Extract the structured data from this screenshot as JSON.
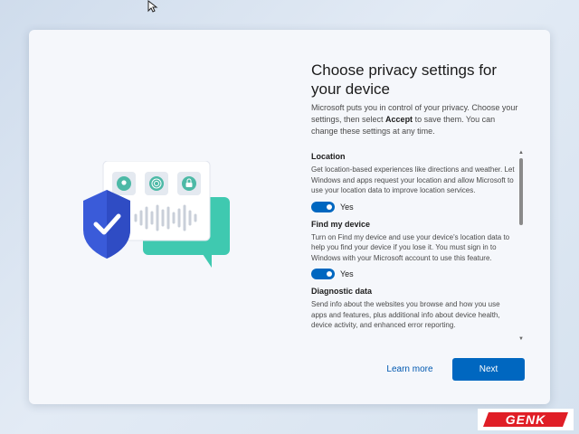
{
  "dialog": {
    "title": "Choose privacy settings for your device",
    "intro_before": "Microsoft puts you in control of your privacy. Choose your settings, then select ",
    "intro_bold": "Accept",
    "intro_after": " to save them. You can change these settings at any time."
  },
  "sections": [
    {
      "title": "Location",
      "description": "Get location-based experiences like directions and weather. Let Windows and apps request your location and allow Microsoft to use your location data to improve location services.",
      "toggle_label": "Yes",
      "toggle_on": true
    },
    {
      "title": "Find my device",
      "description": "Turn on Find my device and use your device's location data to help you find your device if you lose it. You must sign in to Windows with your Microsoft account to use this feature.",
      "toggle_label": "Yes",
      "toggle_on": true
    },
    {
      "title": "Diagnostic data",
      "description": "Send info about the websites you browse and how you use apps and features, plus additional info about device health, device activity, and enhanced error reporting."
    }
  ],
  "buttons": {
    "learn_more": "Learn more",
    "next": "Next"
  },
  "watermark": "GENK",
  "colors": {
    "accent": "#0067c0",
    "shield": "#3a5bd9",
    "chat_bubble": "#3fc9b0",
    "watermark_red": "#e01e26"
  },
  "icons": [
    "mouse-cursor-icon",
    "location-pin-icon",
    "fingerprint-icon",
    "lock-icon",
    "shield-check-icon",
    "chat-bubble-icon",
    "soundwave-icon"
  ]
}
